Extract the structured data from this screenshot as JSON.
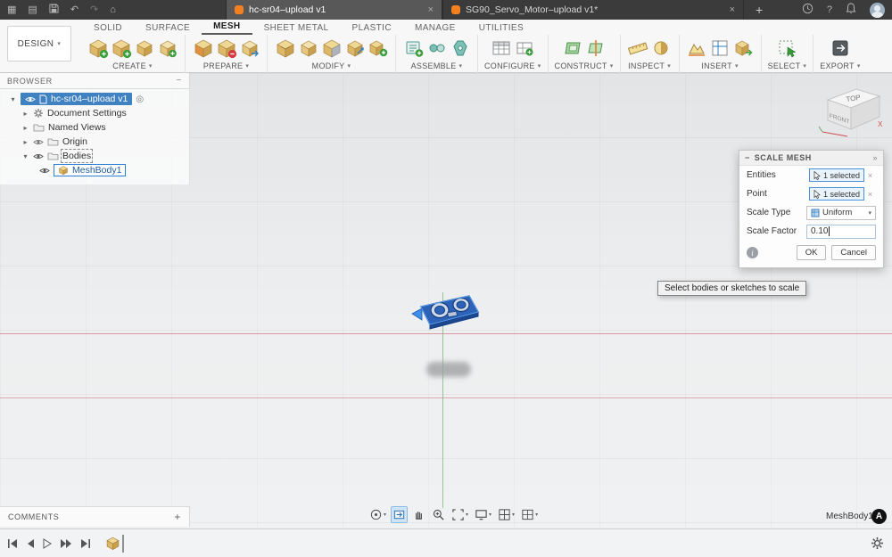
{
  "colors": {
    "accent_blue": "#0696d7",
    "selection_blue": "#3f81c1",
    "axis_red": "#d6787f",
    "axis_green": "#78b478",
    "tab_orange": "#f4801f"
  },
  "icons": {
    "app_grid": "▦",
    "file": "▤",
    "undo": "↶",
    "redo": "↷",
    "home": "⌂",
    "plus": "+",
    "close": "×",
    "chevron_down": "▾",
    "caret_open": "▾",
    "caret_closed": "▸",
    "target": "◎",
    "minimize": "−",
    "expand": "»",
    "help": "?"
  },
  "titlebar": {
    "tabs": [
      {
        "label": "hc-sr04–upload v1"
      },
      {
        "label": "SG90_Servo_Motor–upload v1*"
      }
    ]
  },
  "ribbon": {
    "design_button": "DESIGN",
    "tabs": [
      {
        "label": "SOLID"
      },
      {
        "label": "SURFACE"
      },
      {
        "label": "MESH"
      },
      {
        "label": "SHEET METAL"
      },
      {
        "label": "PLASTIC"
      },
      {
        "label": "MANAGE"
      },
      {
        "label": "UTILITIES"
      }
    ],
    "groups": [
      {
        "label": "CREATE"
      },
      {
        "label": "PREPARE"
      },
      {
        "label": "MODIFY"
      },
      {
        "label": "ASSEMBLE"
      },
      {
        "label": "CONFIGURE"
      },
      {
        "label": "CONSTRUCT"
      },
      {
        "label": "INSPECT"
      },
      {
        "label": "INSERT"
      },
      {
        "label": "SELECT"
      },
      {
        "label": "EXPORT"
      }
    ]
  },
  "browser": {
    "title": "BROWSER",
    "rows": [
      {
        "label": "hc-sr04–upload v1"
      },
      {
        "label": "Document Settings"
      },
      {
        "label": "Named Views"
      },
      {
        "label": "Origin"
      },
      {
        "label": "Bodies"
      },
      {
        "label": "MeshBody1"
      }
    ]
  },
  "viewcube": {
    "top": "TOP",
    "front": "FRONT",
    "axis_x": "X"
  },
  "dialog": {
    "title": "SCALE MESH",
    "fields": {
      "entities_label": "Entities",
      "entities_value": "1 selected",
      "point_label": "Point",
      "point_value": "1 selected",
      "scale_type_label": "Scale Type",
      "scale_type_value": "Uniform",
      "scale_factor_label": "Scale Factor",
      "scale_factor_value": "0.10"
    },
    "ok_label": "OK",
    "cancel_label": "Cancel"
  },
  "tooltip": {
    "text": "Select bodies or sketches to scale"
  },
  "comments": {
    "title": "COMMENTS"
  },
  "canvas": {
    "selected_body_label": "MeshBody1"
  }
}
